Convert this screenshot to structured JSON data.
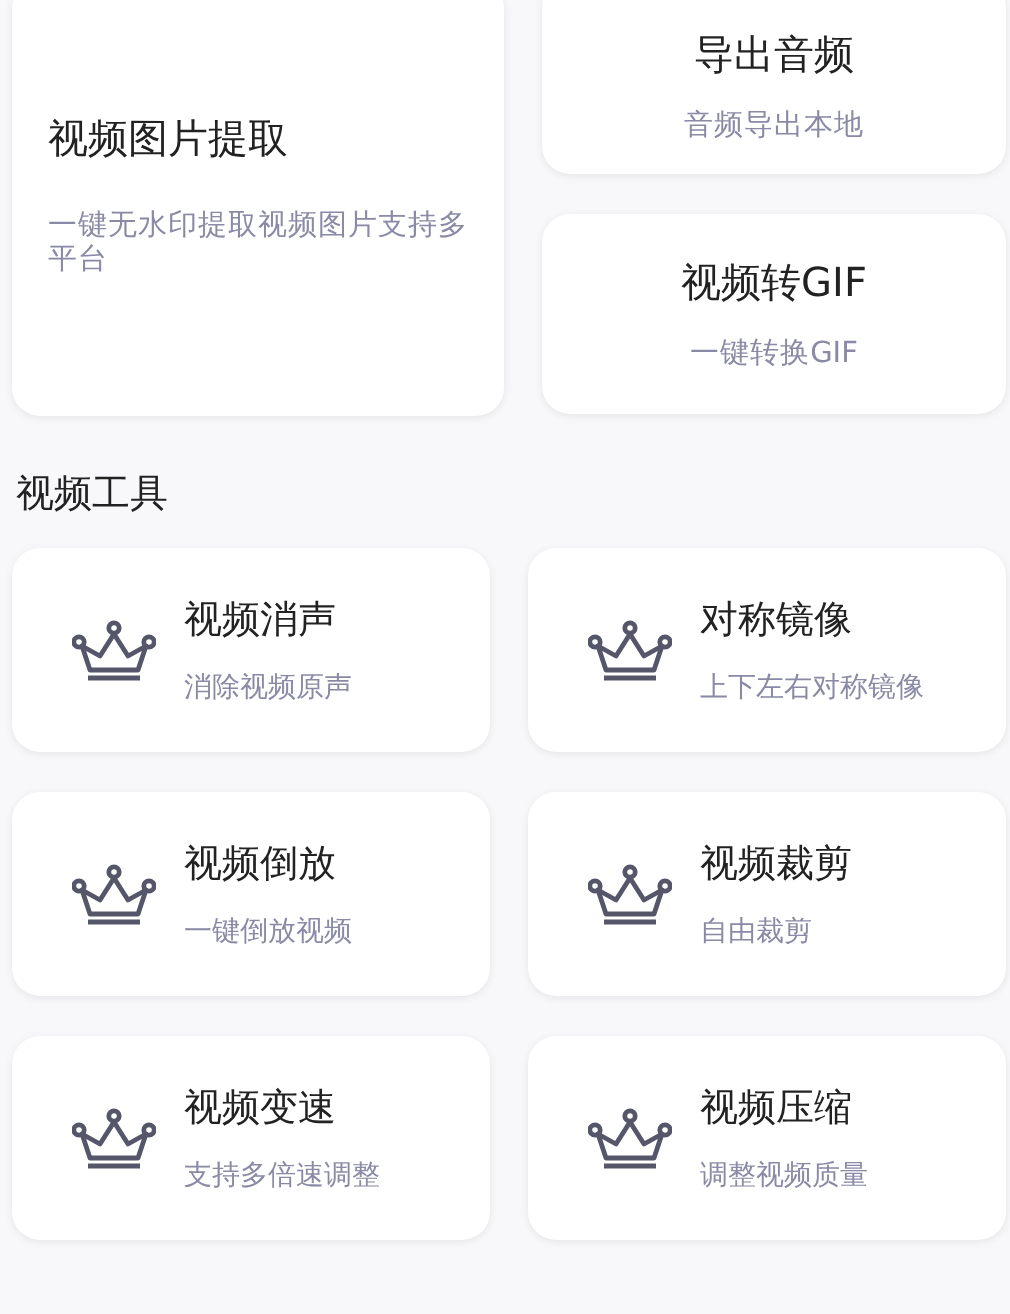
{
  "feature_cards": [
    {
      "title": "视频图片提取",
      "subtitle": "一键无水印提取视频图片支持多平台"
    },
    {
      "title": "导出音频",
      "subtitle": "音频导出本地"
    },
    {
      "title": "视频转GIF",
      "subtitle": "一键转换GIF"
    }
  ],
  "section": {
    "title": "视频工具"
  },
  "tools": [
    {
      "title": "视频消声",
      "subtitle": "消除视频原声"
    },
    {
      "title": "对称镜像",
      "subtitle": "上下左右对称镜像"
    },
    {
      "title": "视频倒放",
      "subtitle": "一键倒放视频"
    },
    {
      "title": "视频裁剪",
      "subtitle": "自由裁剪"
    },
    {
      "title": "视频变速",
      "subtitle": "支持多倍速调整"
    },
    {
      "title": "视频压缩",
      "subtitle": "调整视频质量"
    }
  ]
}
